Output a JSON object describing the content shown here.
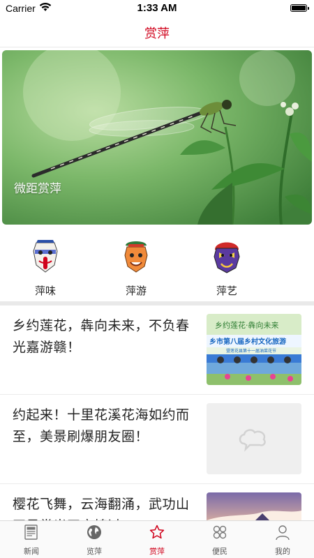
{
  "status": {
    "carrier": "Carrier",
    "time": "1:33 AM"
  },
  "nav": {
    "title": "赏萍"
  },
  "banner": {
    "caption": "微距赏萍"
  },
  "channels": [
    {
      "label": "萍味",
      "icon": "opera-mask-red-icon"
    },
    {
      "label": "萍游",
      "icon": "opera-mask-orange-icon"
    },
    {
      "label": "萍艺",
      "icon": "opera-mask-purple-icon"
    }
  ],
  "news": [
    {
      "title": "乡约莲花，犇向未来，不负春光嘉游赣！",
      "thumb_text": "乡约莲花·犇向未来",
      "thumb_sub": "乡市第八届乡村文化旅游",
      "thumb_sub2": "暨莲花县第十一届油菜花节"
    },
    {
      "title": "约起来！十里花溪花海如约而至，美景刷爆朋友圈！"
    },
    {
      "title": "樱花飞舞，云海翻涌，武功山正是赏光正宜媲过"
    }
  ],
  "tabs": [
    {
      "label": "新闻",
      "icon": "newspaper-icon",
      "active": false
    },
    {
      "label": "览萍",
      "icon": "globe-icon",
      "active": false
    },
    {
      "label": "赏萍",
      "icon": "star-icon",
      "active": true
    },
    {
      "label": "便民",
      "icon": "grid-icon",
      "active": false
    },
    {
      "label": "我的",
      "icon": "person-icon",
      "active": false
    }
  ],
  "colors": {
    "accent": "#d0021b",
    "separator": "#e9e9e9"
  }
}
